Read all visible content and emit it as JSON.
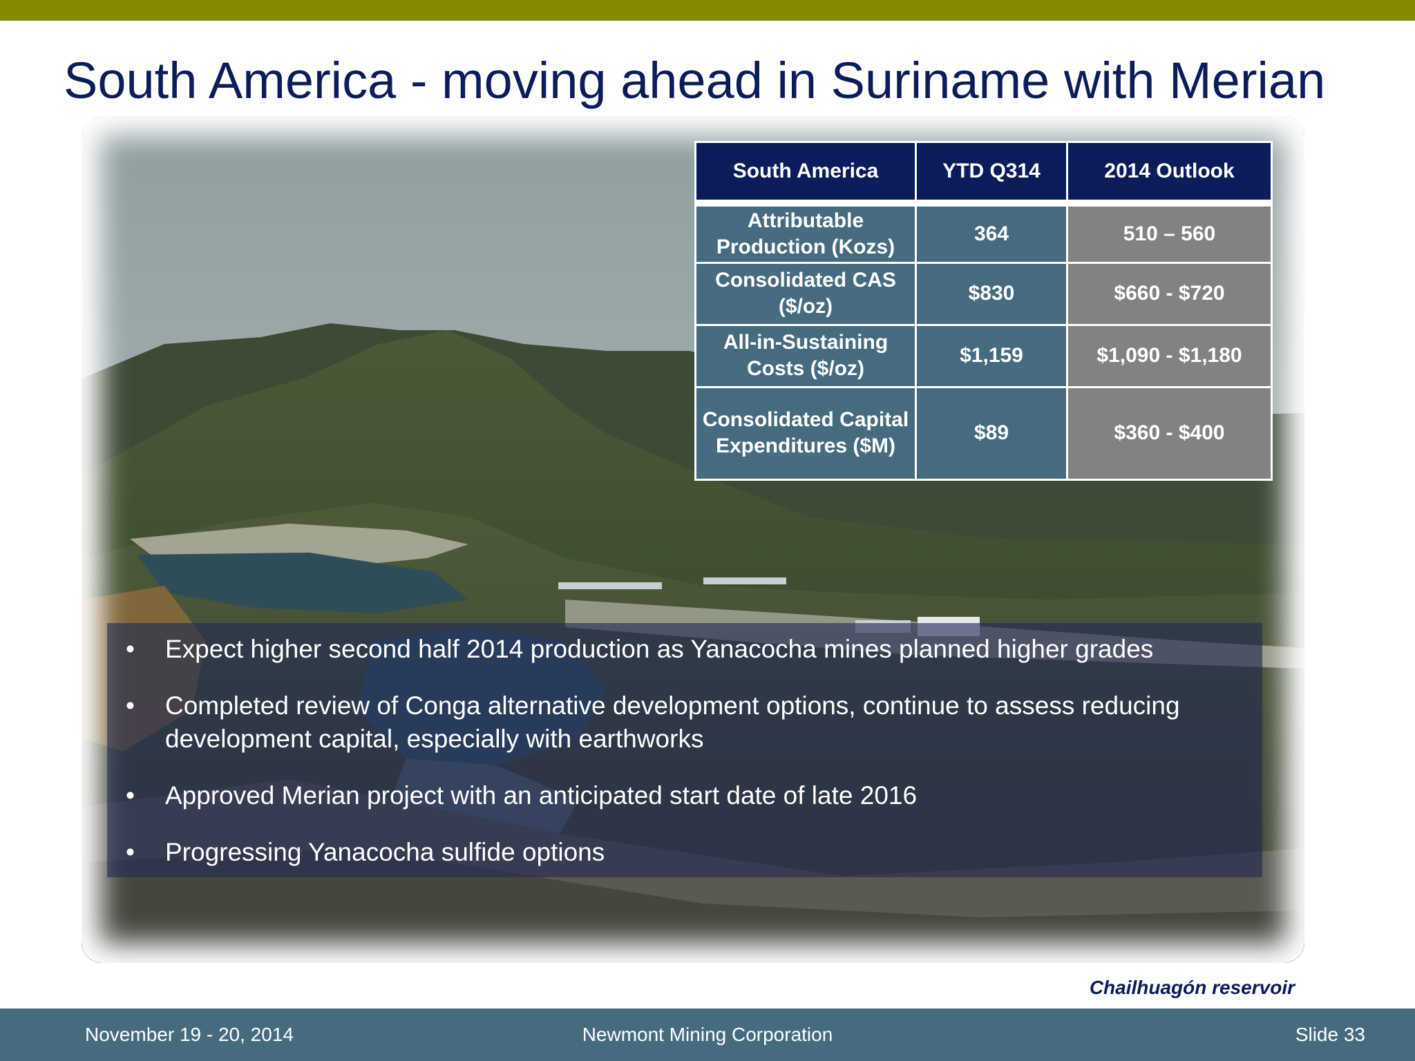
{
  "slide": {
    "title": "South America - moving ahead in Suriname with Merian",
    "caption": "Chailhuagón reservoir"
  },
  "colors": {
    "accent_bar": "#848a00",
    "title_text": "#0c1c5a",
    "table_header": "#0c1c5a",
    "table_body_blue": "#466b7f",
    "table_body_gray": "#828282",
    "footer_bg": "#466b7f"
  },
  "table": {
    "headers": [
      "South America",
      "YTD Q314",
      "2014 Outlook"
    ],
    "rows": [
      {
        "metric": "Attributable Production (Kozs)",
        "ytd": "364",
        "outlook": "510 – 560"
      },
      {
        "metric": "Consolidated CAS ($/oz)",
        "ytd": "$830",
        "outlook": "$660 - $720"
      },
      {
        "metric": "All-in-Sustaining Costs ($/oz)",
        "ytd": "$1,159",
        "outlook": "$1,090 - $1,180"
      },
      {
        "metric": "Consolidated Capital Expenditures ($M)",
        "ytd": "$89",
        "outlook": "$360 - $400"
      }
    ]
  },
  "bullets": [
    "Expect higher second half 2014 production as Yanacocha mines planned higher grades",
    "Completed review of Conga alternative development options, continue to assess reducing development capital, especially with earthworks",
    "Approved Merian project with an anticipated start date of late 2016",
    "Progressing Yanacocha sulfide options"
  ],
  "bullet_symbol": "•",
  "footer": {
    "date": "November 19 - 20, 2014",
    "company": "Newmont Mining Corporation",
    "slide_number": "Slide 33"
  }
}
